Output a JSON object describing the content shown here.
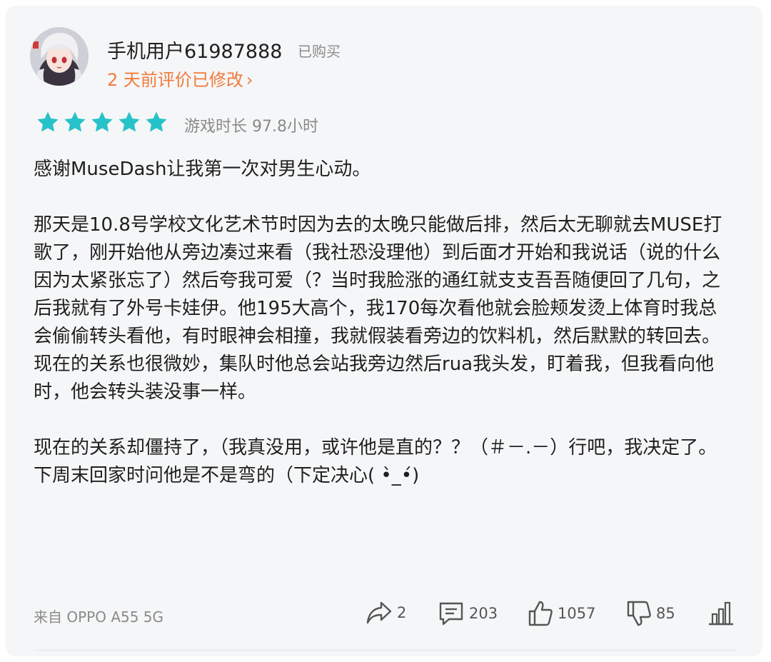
{
  "user": {
    "name": "手机用户61987888",
    "purchase_badge": "已购买",
    "edited_note": "2 天前评价已修改",
    "chevron": "›"
  },
  "rating": {
    "stars": 5,
    "max_stars": 5,
    "star_color": "#26c2c9",
    "playtime": "游戏时长 97.8小时"
  },
  "review": {
    "paragraph1": "感谢MuseDash让我第一次对男生心动。",
    "paragraph2": "那天是10.8号学校文化艺术节时因为去的太晚只能做后排，然后太无聊就去MUSE打歌了，刚开始他从旁边凑过来看（我社恐没理他）到后面才开始和我说话（说的什么因为太紧张忘了）然后夸我可爱（？当时我脸涨的通红就支支吾吾随便回了几句，之后我就有了外号卡娃伊。他195大高个，我170每次看他就会脸颊发烫上体育时我总会偷偷转头看他，有时眼神会相撞，我就假装看旁边的饮料机，然后默默的转回去。现在的关系也很微妙，集队时他总会站我旁边然后rua我头发，盯着我，但我看向他时，他会转头装没事一样。",
    "paragraph3": "现在的关系却僵持了，（我真没用，或许他是直的？？（＃－.－）行吧，我决定了。下周末回家时问他是不是弯的（下定决心( •̀_•́)"
  },
  "footer": {
    "device": "来自 OPPO A55 5G",
    "share_count": "2",
    "comment_count": "203",
    "like_count": "1057",
    "dislike_count": "85"
  },
  "icons": {
    "avatar": "anime-avatar",
    "star": "star-icon",
    "share": "share-icon",
    "comment": "comment-icon",
    "like": "thumbs-up-icon",
    "dislike": "thumbs-down-icon",
    "stats": "bar-chart-icon"
  },
  "colors": {
    "accent_orange": "#f27a3b",
    "star_teal": "#26c2c9",
    "card_bg": "#f5f6f7",
    "muted_text": "#8a8a8a"
  }
}
